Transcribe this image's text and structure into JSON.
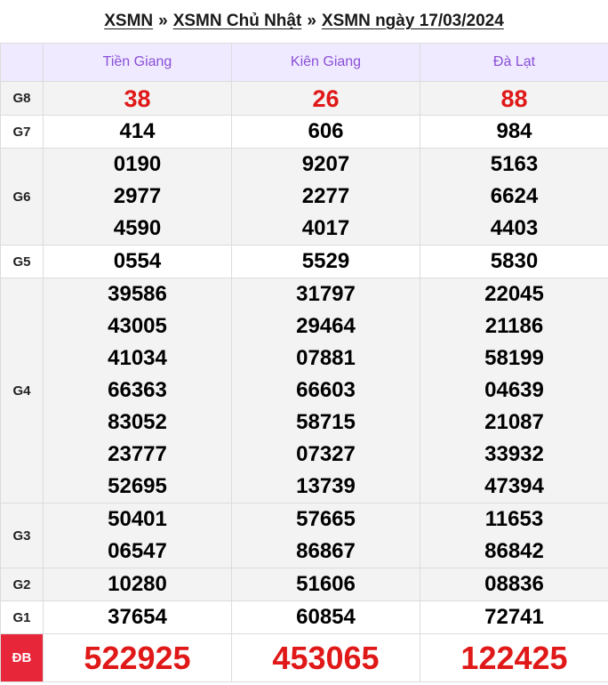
{
  "breadcrumb": {
    "items": [
      "XSMN",
      "XSMN Chủ Nhật",
      "XSMN ngày 17/03/2024"
    ],
    "separator": "»"
  },
  "table": {
    "provinces": [
      "Tiền Giang",
      "Kiên Giang",
      "Đà Lạt"
    ],
    "prizes": [
      {
        "label": "G8",
        "style": "red",
        "values": [
          [
            "38"
          ],
          [
            "26"
          ],
          [
            "88"
          ]
        ]
      },
      {
        "label": "G7",
        "style": "normal",
        "values": [
          [
            "414"
          ],
          [
            "606"
          ],
          [
            "984"
          ]
        ]
      },
      {
        "label": "G6",
        "style": "normal",
        "values": [
          [
            "0190",
            "2977",
            "4590"
          ],
          [
            "9207",
            "2277",
            "4017"
          ],
          [
            "5163",
            "6624",
            "4403"
          ]
        ]
      },
      {
        "label": "G5",
        "style": "normal",
        "values": [
          [
            "0554"
          ],
          [
            "5529"
          ],
          [
            "5830"
          ]
        ]
      },
      {
        "label": "G4",
        "style": "normal",
        "values": [
          [
            "39586",
            "43005",
            "41034",
            "66363",
            "83052",
            "23777",
            "52695"
          ],
          [
            "31797",
            "29464",
            "07881",
            "66603",
            "58715",
            "07327",
            "13739"
          ],
          [
            "22045",
            "21186",
            "58199",
            "04639",
            "21087",
            "33932",
            "47394"
          ]
        ]
      },
      {
        "label": "G3",
        "style": "normal",
        "values": [
          [
            "50401",
            "06547"
          ],
          [
            "57665",
            "86867"
          ],
          [
            "11653",
            "86842"
          ]
        ]
      },
      {
        "label": "G2",
        "style": "normal",
        "values": [
          [
            "10280"
          ],
          [
            "51606"
          ],
          [
            "08836"
          ]
        ]
      },
      {
        "label": "G1",
        "style": "normal",
        "values": [
          [
            "37654"
          ],
          [
            "60854"
          ],
          [
            "72741"
          ]
        ]
      },
      {
        "label": "ĐB",
        "style": "big",
        "values": [
          [
            "522925"
          ],
          [
            "453065"
          ],
          [
            "122425"
          ]
        ]
      }
    ]
  },
  "colors": {
    "header_bg": "#efeaff",
    "header_text": "#8a4fd8",
    "highlight_red": "#e01818",
    "db_label_bg": "#e8263a"
  }
}
